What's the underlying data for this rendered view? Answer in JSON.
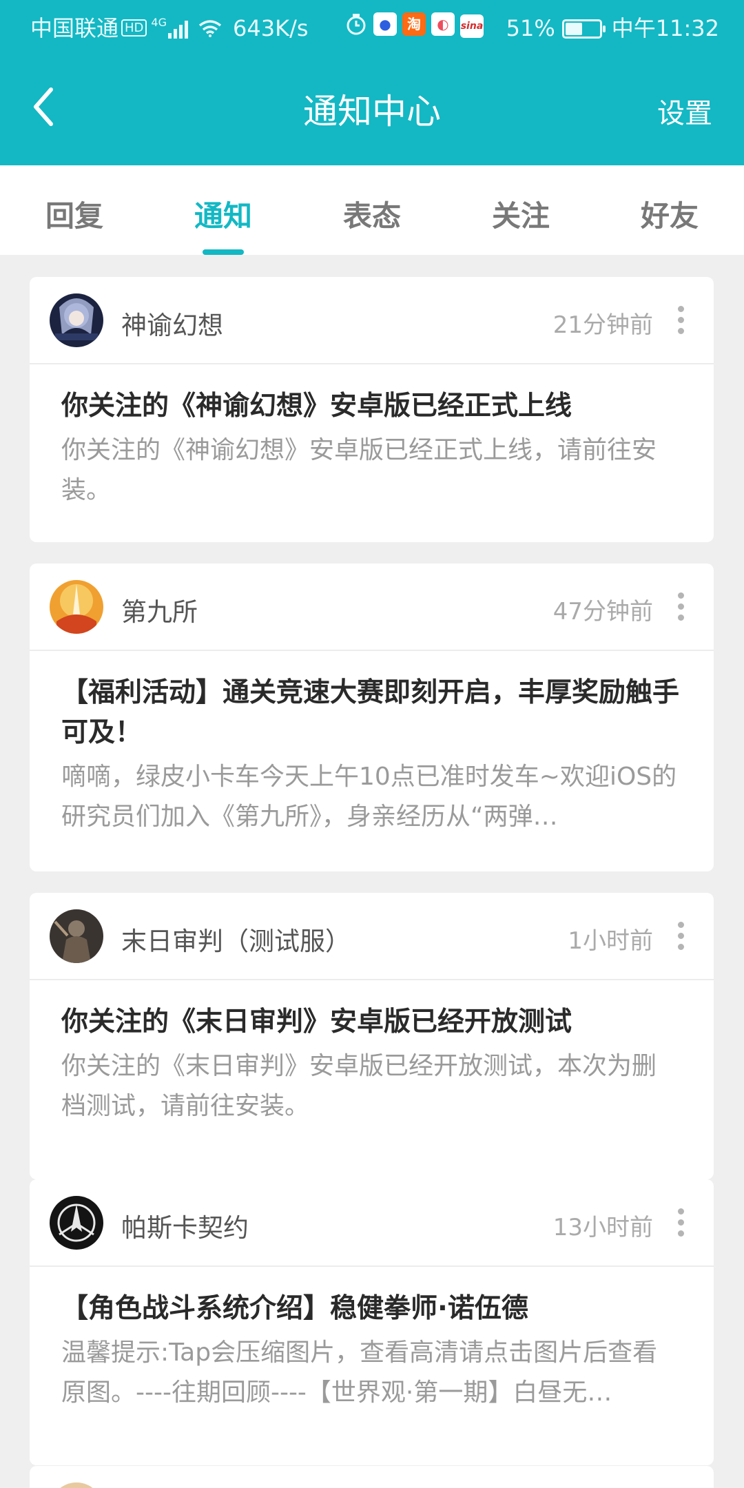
{
  "status_bar": {
    "carrier": "中国联通",
    "hd_badge": "HD",
    "network": "4G",
    "speed": "643K/s",
    "app_icons": [
      "alarm-icon",
      "baidu-icon",
      "taobao-icon",
      "weibo-icon",
      "sina-icon"
    ],
    "taobao_label": "淘",
    "sina_label": "sina",
    "battery_percent": "51%",
    "battery_level": 0.51,
    "time": "中午11:32"
  },
  "header": {
    "back_icon": "back-arrow-icon",
    "title": "通知中心",
    "settings_label": "设置",
    "color": "#13b8c4"
  },
  "tabs": [
    {
      "label": "回复",
      "active": false
    },
    {
      "label": "通知",
      "active": true
    },
    {
      "label": "表态",
      "active": false
    },
    {
      "label": "关注",
      "active": false
    },
    {
      "label": "好友",
      "active": false
    }
  ],
  "notifications": [
    {
      "source": "神谕幻想",
      "time": "21分钟前",
      "title": "你关注的《神谕幻想》安卓版已经正式上线",
      "body": "你关注的《神谕幻想》安卓版已经正式上线，请前往安装。"
    },
    {
      "source": "第九所",
      "time": "47分钟前",
      "title": "【福利活动】通关竞速大赛即刻开启，丰厚奖励触手可及！",
      "body": "嘀嘀，绿皮小卡车今天上午10点已准时发车~欢迎iOS的研究员们加入《第九所》，身亲经历从“两弹…"
    },
    {
      "source": "末日审判（测试服）",
      "time": "1小时前",
      "title": "你关注的《末日审判》安卓版已经开放测试",
      "body": "你关注的《末日审判》安卓版已经开放测试，本次为删档测试，请前往安装。"
    },
    {
      "source": "帕斯卡契约",
      "time": "13小时前",
      "title": "【角色战斗系统介绍】稳健拳师·诺伍德",
      "body": "温馨提示:Tap会压缩图片，查看高清请点击图片后查看原图。----往期回顾----【世界观·第一期】白昼无…"
    }
  ]
}
